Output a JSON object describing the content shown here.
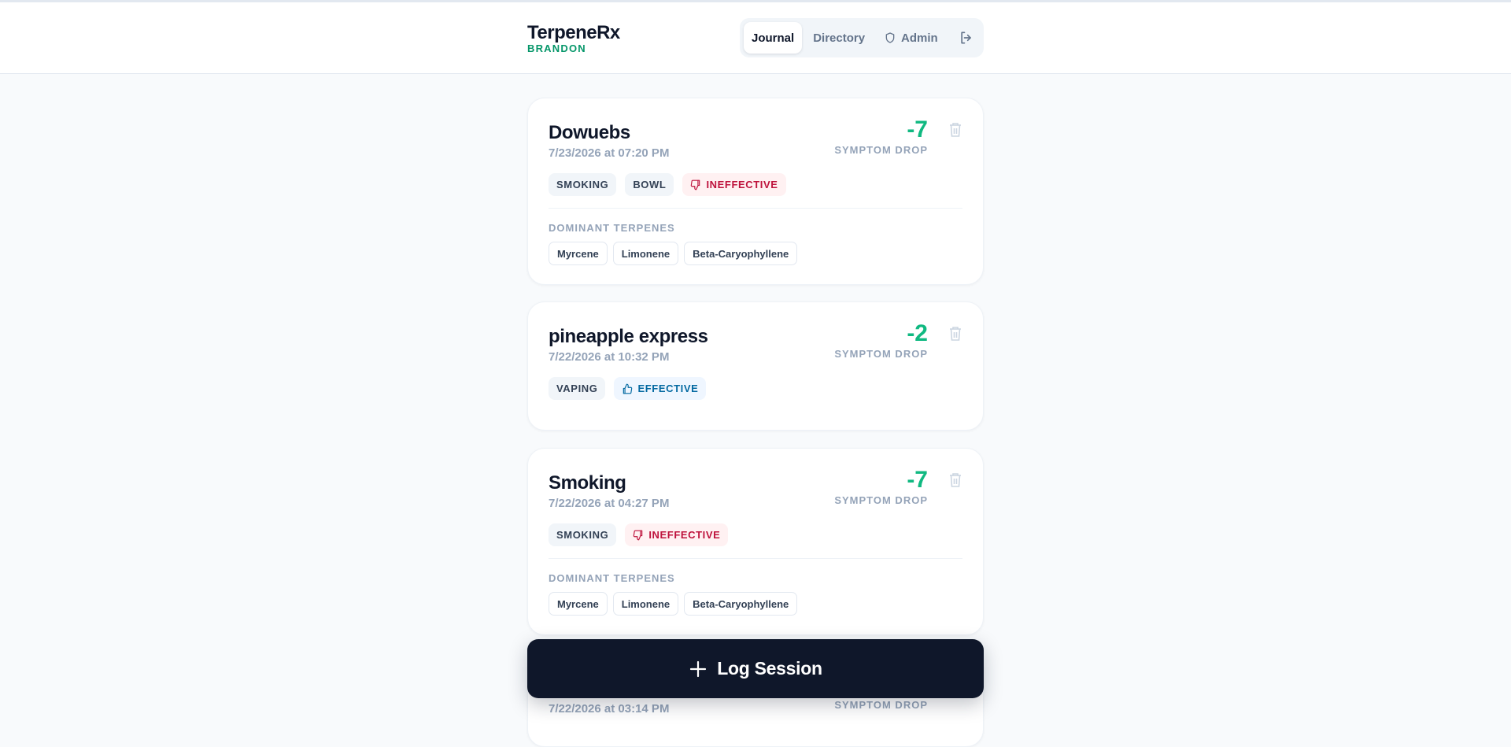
{
  "app": {
    "name": "TerpeneRx",
    "user": "BRANDON"
  },
  "nav": {
    "tabs": [
      {
        "label": "Journal",
        "active": true
      },
      {
        "label": "Directory",
        "active": false
      },
      {
        "label": "Admin",
        "active": false,
        "icon": "shield-icon"
      }
    ],
    "logout_icon": "logout-icon"
  },
  "common": {
    "score_label": "SYMPTOM DROP",
    "terpenes_label": "DOMINANT TERPENES"
  },
  "sessions": [
    {
      "name": "Dowuebs",
      "date": "7/23/2026 at 07:20 PM",
      "score": "-7",
      "tags": [
        "SMOKING",
        "BOWL"
      ],
      "verdict": "INEFFECTIVE",
      "terpenes": [
        "Myrcene",
        "Limonene",
        "Beta-Caryophyllene"
      ]
    },
    {
      "name": "pineapple express",
      "date": "7/22/2026 at 10:32 PM",
      "score": "-2",
      "tags": [
        "VAPING"
      ],
      "verdict": "EFFECTIVE",
      "terpenes": []
    },
    {
      "name": "Smoking",
      "date": "7/22/2026 at 04:27 PM",
      "score": "-7",
      "tags": [
        "SMOKING"
      ],
      "verdict": "INEFFECTIVE",
      "terpenes": [
        "Myrcene",
        "Limonene",
        "Beta-Caryophyllene"
      ]
    },
    {
      "name": "",
      "date": "7/22/2026 at 03:14 PM",
      "score": "",
      "tags": [],
      "verdict": "",
      "terpenes": []
    }
  ],
  "fab": {
    "label": "Log Session"
  },
  "colors": {
    "brand_user": "#059669",
    "score": "#10b981",
    "ineffective": "#be123c",
    "effective": "#0369a1",
    "fab_bg": "#0f172a"
  }
}
